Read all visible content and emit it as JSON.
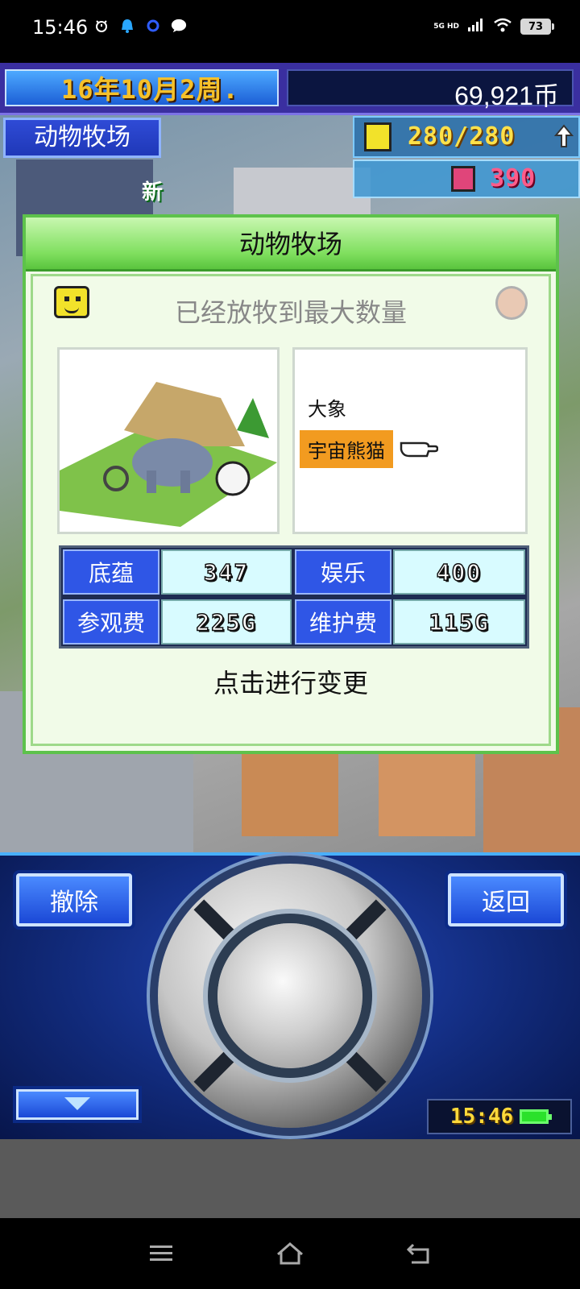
{
  "status_bar": {
    "time": "15:46",
    "network": "5G HD",
    "battery": "73",
    "icons": [
      "alarm-icon",
      "bell-icon",
      "circle-app-icon",
      "chat-icon",
      "signal-icon",
      "wifi-icon"
    ]
  },
  "game": {
    "date": "16年10月2周.",
    "money": "69,921币",
    "facility_label": "动物牧场",
    "capacity": "280/280",
    "points": "390",
    "map_label": "新",
    "dialog": {
      "title": "动物牧场",
      "message": "已经放牧到最大数量",
      "animals": [
        "大象",
        "宇宙熊猫"
      ],
      "selected_animal": "宇宙熊猫",
      "stats": [
        {
          "label": "底蕴",
          "value": "347"
        },
        {
          "label": "娱乐",
          "value": "400"
        },
        {
          "label": "参观费",
          "value": "225G"
        },
        {
          "label": "维护费",
          "value": "115G"
        }
      ],
      "change_hint": "点击进行变更"
    }
  },
  "controls": {
    "remove_button": "撤除",
    "back_button": "返回",
    "clock": "15:46"
  },
  "colors": {
    "dialog_green": "#5dc24b",
    "selected_orange": "#f29b20",
    "button_blue": "#1b48d6",
    "stat_label_blue": "#2f56e6"
  }
}
